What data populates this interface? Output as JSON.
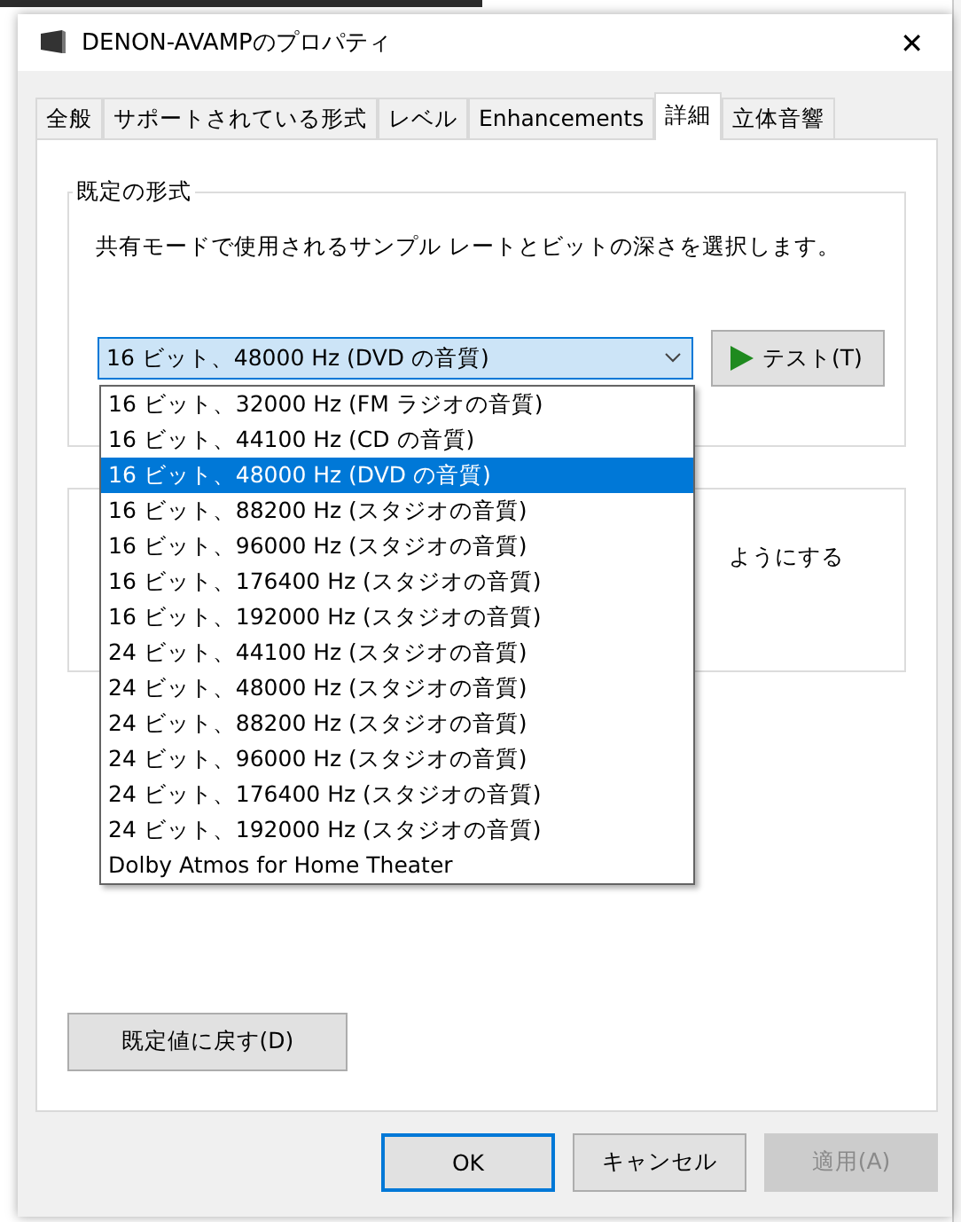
{
  "window": {
    "title": "DENON-AVAMPのプロパティ",
    "close": "✕"
  },
  "tabs": [
    {
      "label": "全般",
      "selected": false
    },
    {
      "label": "サポートされている形式",
      "selected": false
    },
    {
      "label": "レベル",
      "selected": false
    },
    {
      "label": "Enhancements",
      "selected": false
    },
    {
      "label": "詳細",
      "selected": true
    },
    {
      "label": "立体音響",
      "selected": false
    }
  ],
  "default_format": {
    "title": "既定の形式",
    "description": "共有モードで使用されるサンプル レートとビットの深さを選択します。",
    "dropdown": {
      "value": "16 ビット、48000 Hz (DVD の音質)",
      "expanded": true,
      "options": [
        {
          "label": "16 ビット、32000 Hz (FM ラジオの音質)",
          "selected": false
        },
        {
          "label": "16 ビット、44100 Hz (CD の音質)",
          "selected": false
        },
        {
          "label": "16 ビット、48000 Hz (DVD の音質)",
          "selected": true
        },
        {
          "label": "16 ビット、88200 Hz (スタジオの音質)",
          "selected": false
        },
        {
          "label": "16 ビット、96000 Hz (スタジオの音質)",
          "selected": false
        },
        {
          "label": "16 ビット、176400 Hz (スタジオの音質)",
          "selected": false
        },
        {
          "label": "16 ビット、192000 Hz (スタジオの音質)",
          "selected": false
        },
        {
          "label": "24 ビット、44100 Hz (スタジオの音質)",
          "selected": false
        },
        {
          "label": "24 ビット、48000 Hz (スタジオの音質)",
          "selected": false
        },
        {
          "label": "24 ビット、88200 Hz (スタジオの音質)",
          "selected": false
        },
        {
          "label": "24 ビット、96000 Hz (スタジオの音質)",
          "selected": false
        },
        {
          "label": "24 ビット、176400 Hz (スタジオの音質)",
          "selected": false
        },
        {
          "label": "24 ビット、192000 Hz (スタジオの音質)",
          "selected": false
        },
        {
          "label": "Dolby Atmos for Home Theater",
          "selected": false
        }
      ]
    },
    "test_button": "テスト(T)"
  },
  "exclusive_group": {
    "description_fragment": "ようにする"
  },
  "reset_button": "既定値に戻す(D)",
  "buttons": [
    {
      "label": "OK",
      "kind": "default",
      "disabled": false
    },
    {
      "label": "キャンセル",
      "kind": "normal",
      "disabled": false
    },
    {
      "label": "適用(A)",
      "kind": "normal",
      "disabled": true
    }
  ]
}
